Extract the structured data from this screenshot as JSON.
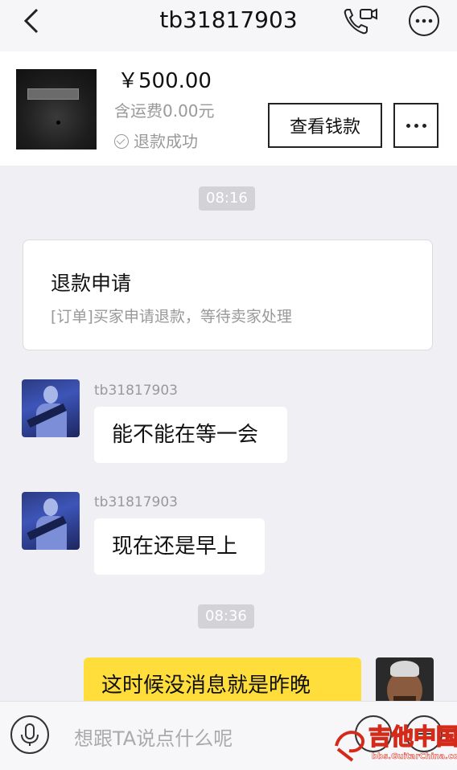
{
  "header": {
    "title": "tb31817903",
    "back_icon": "chevron-left-icon",
    "call_icon": "phone-video-icon",
    "more_icon": "ellipsis-circle-icon"
  },
  "order": {
    "price": "￥500.00",
    "shipping": "含运费0.00元",
    "status": "退款成功",
    "view_button": "查看钱款"
  },
  "messages": {
    "time1": "08:16",
    "refund_card": {
      "title": "退款申请",
      "text": "[订单]买家申请退款，等待卖家处理"
    },
    "msg1": {
      "sender": "tb31817903",
      "text": "能不能在等一会"
    },
    "msg2": {
      "sender": "tb31817903",
      "text": "现在还是早上"
    },
    "time2": "08:36",
    "msg3": {
      "text": "这时候没消息就是昨晚"
    }
  },
  "input": {
    "placeholder": "想跟TA说点什么呢"
  },
  "watermark": {
    "name": "吉他中国",
    "url": "bbs.GuitarChina.com"
  },
  "colors": {
    "self_bubble": "#ffde3b",
    "background": "#efeff4"
  }
}
